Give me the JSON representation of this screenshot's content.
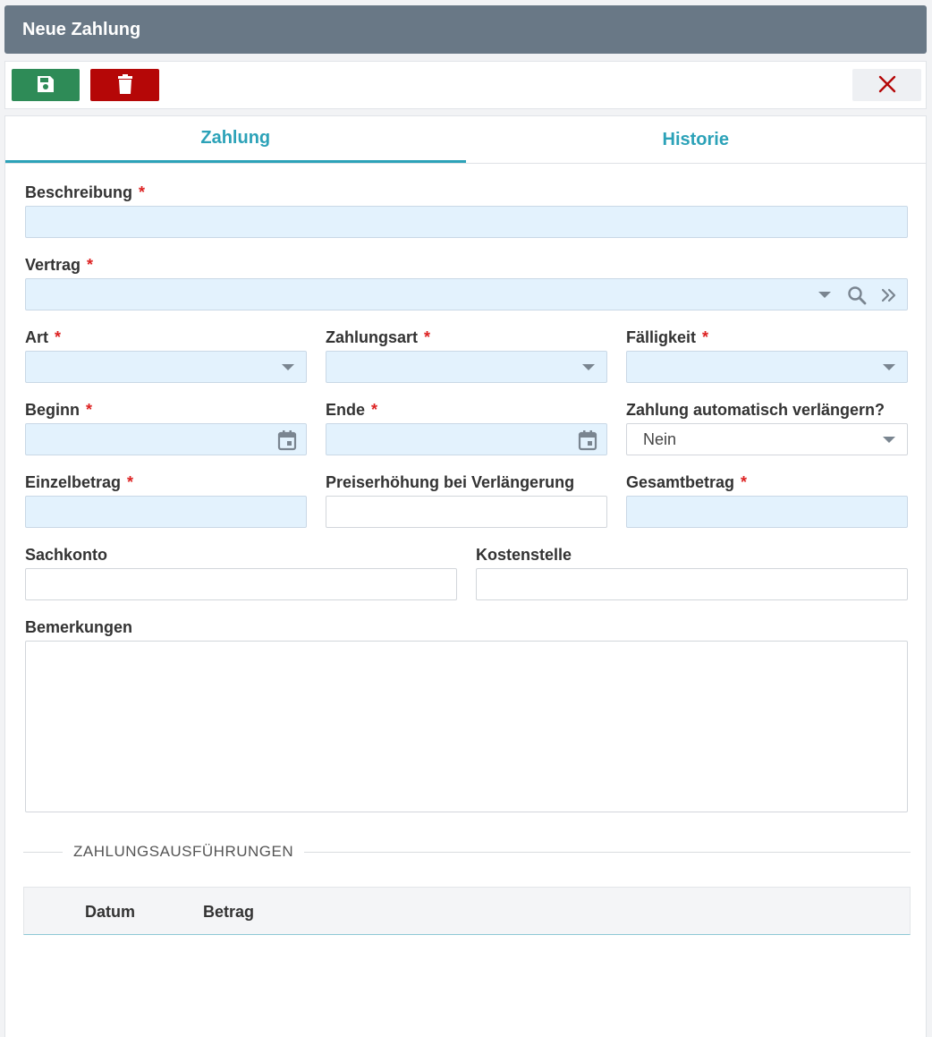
{
  "window": {
    "title": "Neue Zahlung"
  },
  "toolbar": {
    "save_icon": "floppy-disk-icon",
    "delete_icon": "trash-icon",
    "close_icon": "close-icon",
    "save_color": "#2e8b57",
    "delete_color": "#b50707",
    "close_color": "#b50707"
  },
  "tabs": [
    {
      "label": "Zahlung",
      "active": true
    },
    {
      "label": "Historie",
      "active": false
    }
  ],
  "form": {
    "required_mark": "*",
    "beschreibung": {
      "label": "Beschreibung",
      "value": ""
    },
    "vertrag": {
      "label": "Vertrag",
      "value": ""
    },
    "art": {
      "label": "Art",
      "value": ""
    },
    "zahlungsart": {
      "label": "Zahlungsart",
      "value": ""
    },
    "faelligkeit": {
      "label": "Fälligkeit",
      "value": ""
    },
    "beginn": {
      "label": "Beginn",
      "value": ""
    },
    "ende": {
      "label": "Ende",
      "value": ""
    },
    "verlaengern": {
      "label": "Zahlung automatisch verlängern?",
      "value": "Nein"
    },
    "einzelbetrag": {
      "label": "Einzelbetrag",
      "value": ""
    },
    "preiserhoehung": {
      "label": "Preiserhöhung bei Verlängerung",
      "value": ""
    },
    "gesamtbetrag": {
      "label": "Gesamtbetrag",
      "value": ""
    },
    "sachkonto": {
      "label": "Sachkonto",
      "value": ""
    },
    "kostenstelle": {
      "label": "Kostenstelle",
      "value": ""
    },
    "bemerkungen": {
      "label": "Bemerkungen",
      "value": ""
    }
  },
  "section": {
    "title": "ZAHLUNGSAUSFÜHRUNGEN",
    "columns": [
      "Datum",
      "Betrag"
    ],
    "rows": []
  }
}
